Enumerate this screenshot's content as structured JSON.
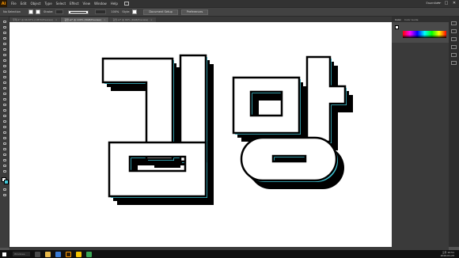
{
  "app": {
    "logo": "Ai"
  },
  "menu": [
    "File",
    "Edit",
    "Object",
    "Type",
    "Select",
    "Effect",
    "View",
    "Window",
    "Help"
  ],
  "workspace": "Essentials",
  "window_controls": [
    "—",
    "□",
    "✕"
  ],
  "control_bar": {
    "selection_label": "No Selection",
    "stroke_label": "Stroke:",
    "opacity_value": "100%",
    "style_label": "Style:",
    "document_setup": "Document Setup",
    "preferences": "Preferences"
  },
  "doc_tabs": [
    {
      "label": "무제-1* @ 66.67% (CMYK/Preview)",
      "active": false
    },
    {
      "label": "김망.ai* @ 100% (RGB/Preview)",
      "active": true
    },
    {
      "label": "김망.ai* @ 66% (RGB/Preview)",
      "active": false
    }
  ],
  "panel": {
    "tabs": [
      "Color",
      "Color Guide"
    ]
  },
  "artwork": {
    "text": "김망"
  },
  "taskbar": {
    "search": "Windows",
    "time": "오후 10:51",
    "date": "2019-01-23"
  },
  "colors": {
    "accent_cyan": "#41c7d8",
    "fill": "#ffffff",
    "shadow": "#000000",
    "logo": "#ff9a00"
  }
}
